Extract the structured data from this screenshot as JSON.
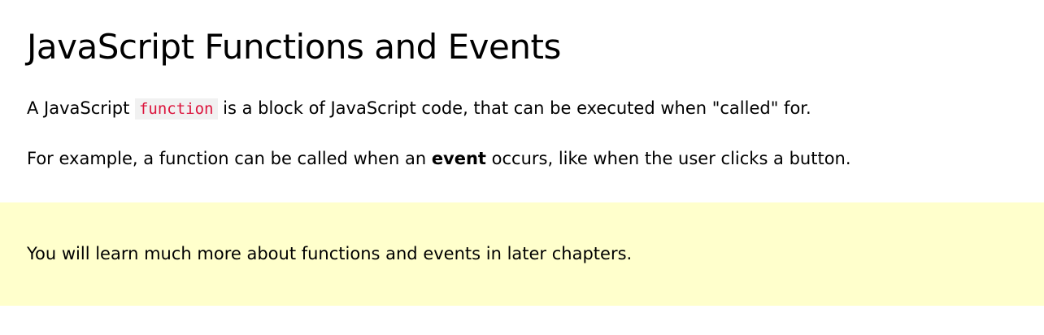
{
  "page": {
    "title": "JavaScript Functions and Events",
    "intro": {
      "before": "A JavaScript ",
      "code": "function",
      "after": " is a block of JavaScript code, that can be executed when \"called\" for."
    },
    "example": {
      "before": "For example, a function can be called when an ",
      "bold": "event",
      "after": " occurs, like when the user clicks a button."
    },
    "note": {
      "text": "You will learn much more about functions and events in later chapters."
    }
  },
  "colors": {
    "code_text": "#dc143c",
    "code_background": "#f1f1f1",
    "note_background": "#ffffcc"
  }
}
